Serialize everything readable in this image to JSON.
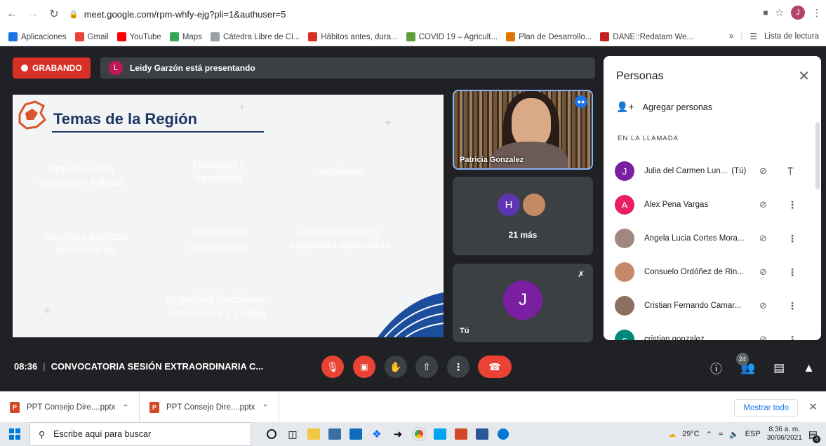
{
  "browser": {
    "url": "meet.google.com/rpm-whfy-ejg?pli=1&authuser=5",
    "profile_initial": "J",
    "bookmarks": [
      {
        "label": "Aplicaciones",
        "color": "#1a73e8"
      },
      {
        "label": "Gmail",
        "color": "#ea4335"
      },
      {
        "label": "YouTube",
        "color": "#ff0000"
      },
      {
        "label": "Maps",
        "color": "#34a853"
      },
      {
        "label": "Cátedra Libre de Ci...",
        "color": "#9aa0a6"
      },
      {
        "label": "Hábitos antes, dura...",
        "color": "#d93025"
      },
      {
        "label": "COVID 19 – Agricult...",
        "color": "#5f9e3a"
      },
      {
        "label": "Plan de Desarrollo...",
        "color": "#e37400"
      },
      {
        "label": "DANE::Redatam We...",
        "color": "#c5221f"
      }
    ],
    "more_bookmarks": "»",
    "reading_list": "Lista de lectura"
  },
  "meet": {
    "recording_label": "GRABANDO",
    "presenter_initial": "L",
    "presenting_text": "Leidy Garzón está presentando",
    "slide": {
      "title": "Temas de la Región",
      "tiles": [
        {
          "label": "Ordenamiento territorial y hábitat",
          "color": "#f37735"
        },
        {
          "label": "Movilidad y transporte",
          "color": "#5ea23a"
        },
        {
          "label": "Ambiente",
          "color": "#fbb400"
        },
        {
          "label": "Servicios públicos domiciliarios",
          "color": "#4a90d9"
        },
        {
          "label": "Desarrollo económico",
          "color": "#a5a5a5"
        },
        {
          "label": "Abastecimiento y seguridad alimentaria",
          "color": "#6aa33c"
        },
        {
          "label": "Seguridad ciudadana, convivencia y justicia",
          "color": "#1f3a68"
        }
      ]
    },
    "video_name": "Patricia Gonzalez",
    "more_initial": "H",
    "more_label": "21 más",
    "you_initial": "J",
    "you_label": "Tú",
    "meeting_time": "08:36",
    "meeting_title": "CONVOCATORIA SESIÓN EXTRAORDINARIA C...",
    "participant_count": "24"
  },
  "people_panel": {
    "title": "Personas",
    "add_label": "Agregar personas",
    "section_label": "EN LA LLAMADA",
    "people": [
      {
        "name": "Julia del Carmen Lun...",
        "suffix": "(Tú)",
        "initial": "J",
        "color": "#7b1fa2"
      },
      {
        "name": "Alex Pena Vargas",
        "suffix": "",
        "initial": "A",
        "color": "#e91e63"
      },
      {
        "name": "Angela Lucia Cortes Mora...",
        "suffix": "",
        "initial": "",
        "color": "#a1887f"
      },
      {
        "name": "Consuelo Ordóñez de Rin...",
        "suffix": "",
        "initial": "",
        "color": "#c28a6b"
      },
      {
        "name": "Cristian Fernando Camar...",
        "suffix": "",
        "initial": "",
        "color": "#8d6e63"
      },
      {
        "name": "cristian gonzalez",
        "suffix": "",
        "initial": "c",
        "color": "#00897b"
      }
    ]
  },
  "downloads": {
    "items": [
      "PPT Consejo Dire....pptx",
      "PPT Consejo Dire....pptx"
    ],
    "show_all": "Mostrar todo"
  },
  "taskbar": {
    "search_placeholder": "Escribe aquí para buscar",
    "temperature": "29°C",
    "language": "ESP",
    "time": "8:36 a. m.",
    "date": "30/06/2021",
    "notif_count": "4"
  }
}
